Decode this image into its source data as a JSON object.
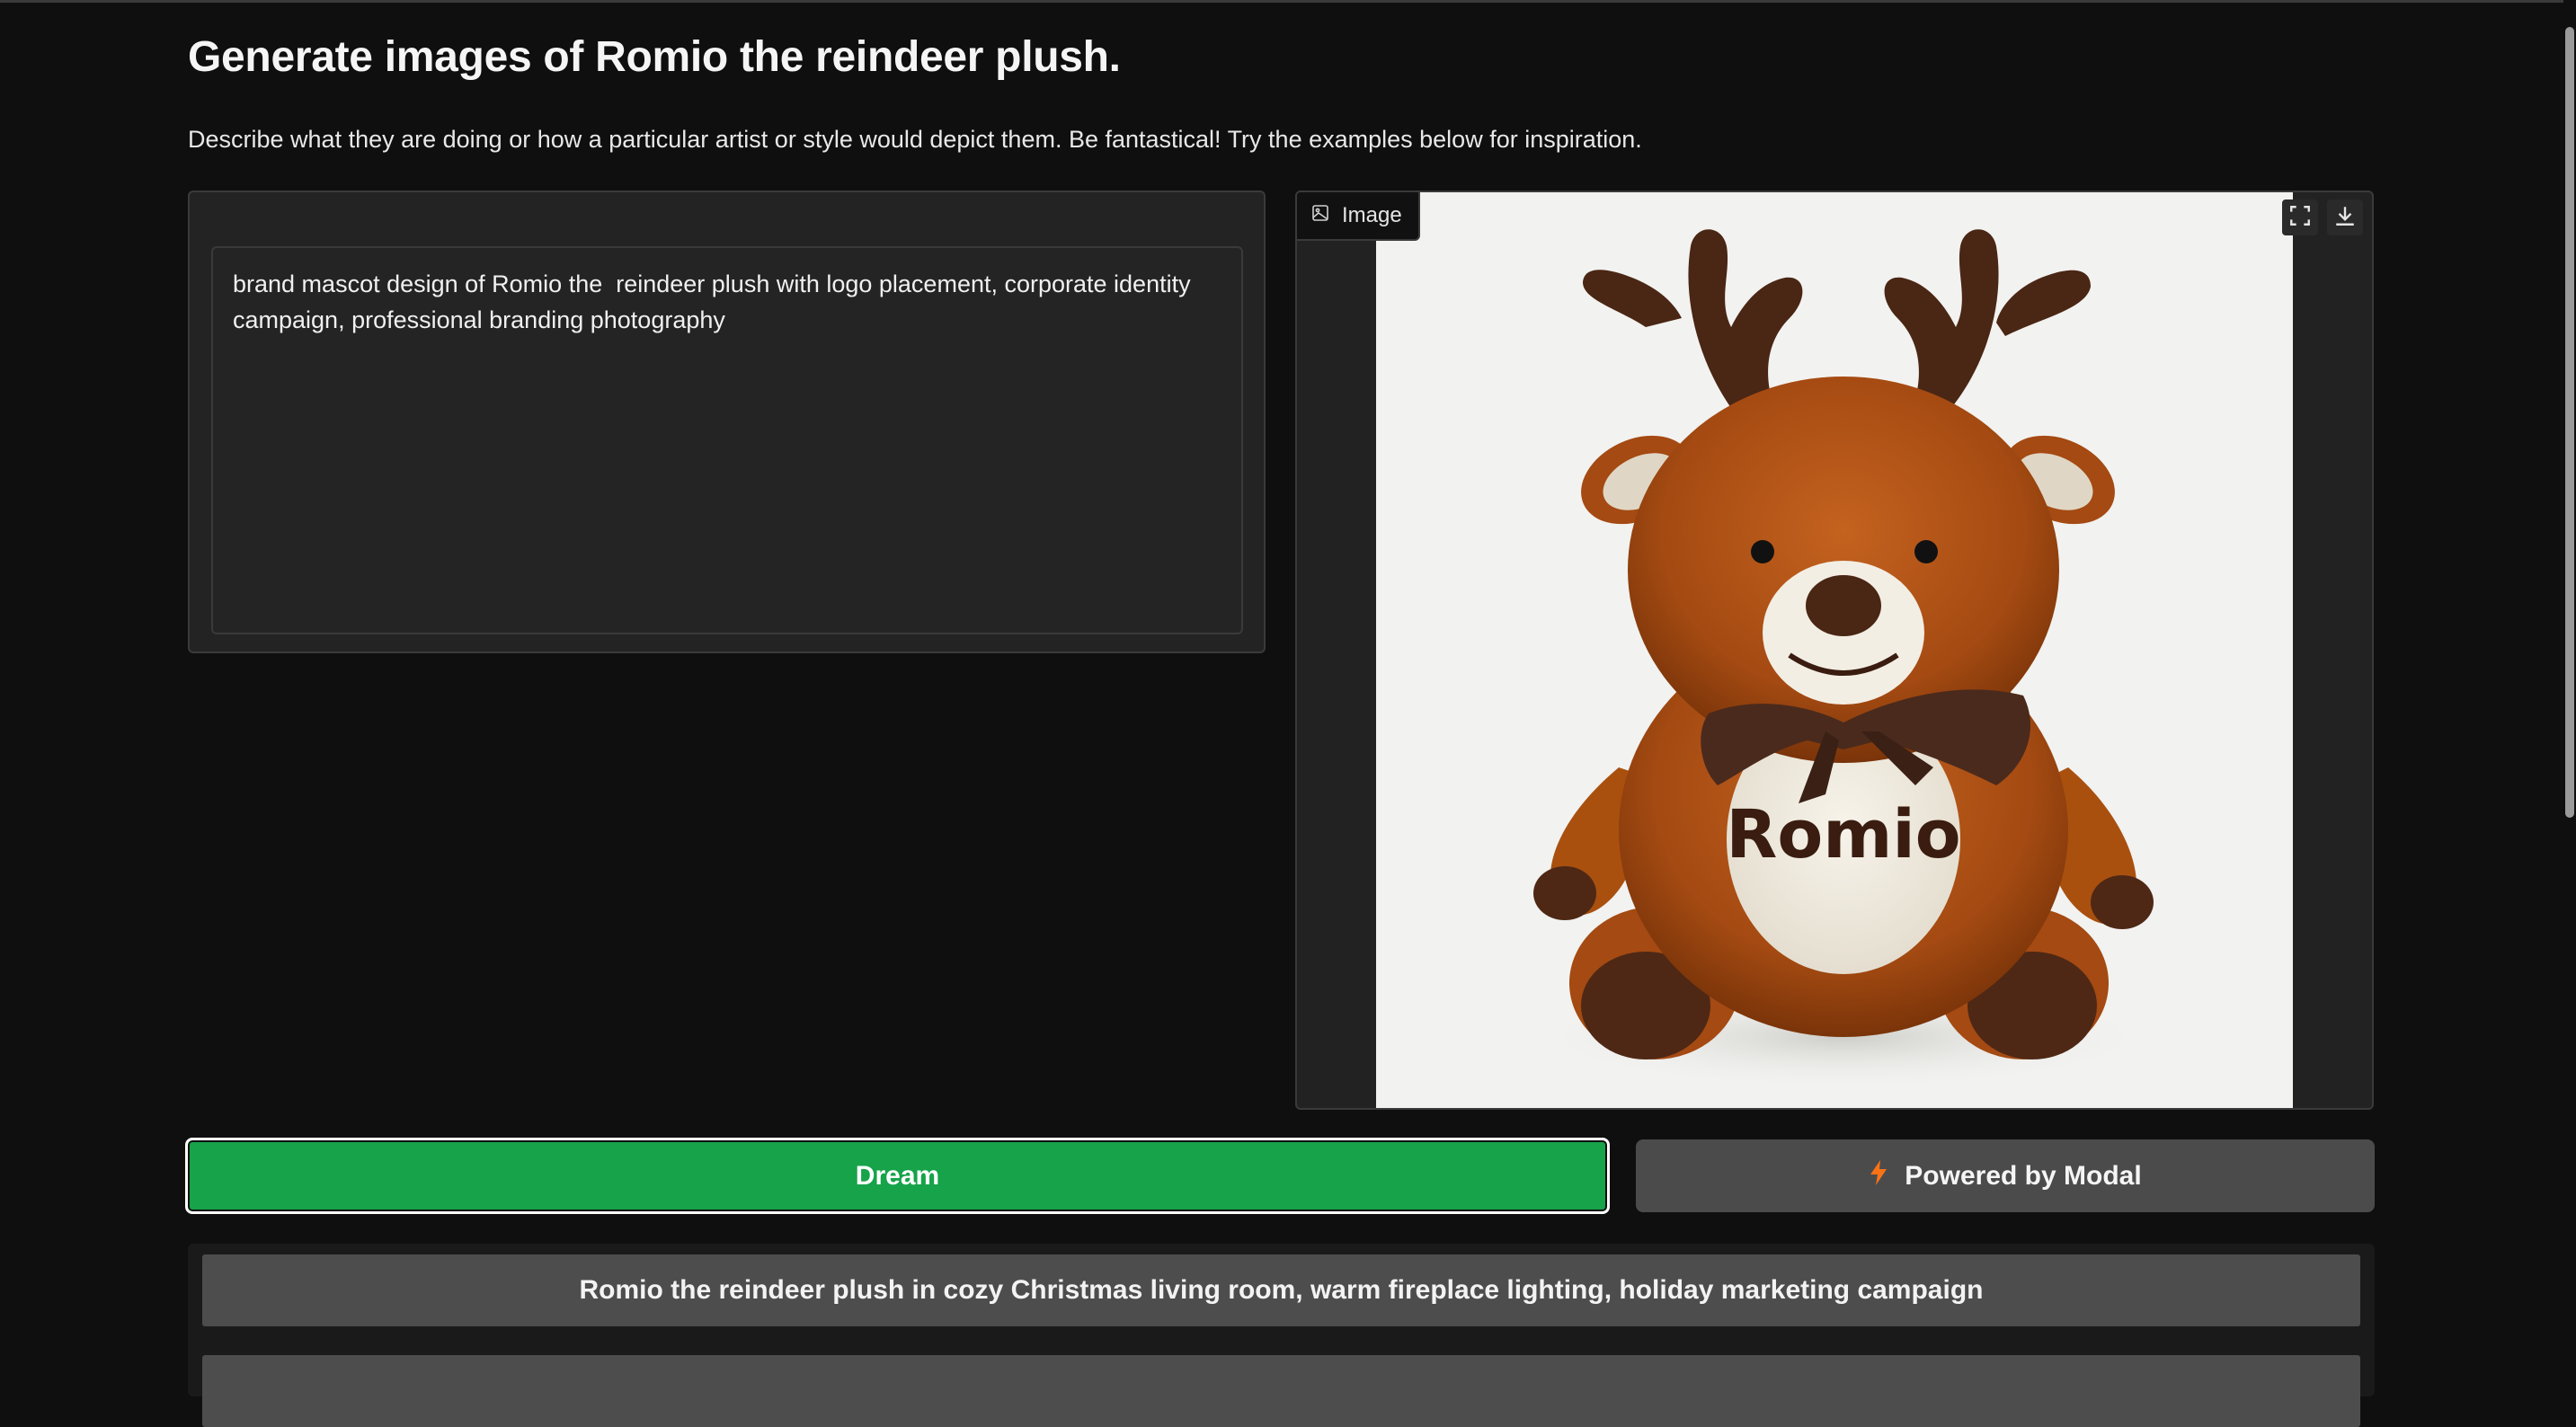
{
  "header": {
    "title": "Generate images of Romio the reindeer plush.",
    "description": "Describe what they are doing or how a particular artist or style would depict them. Be fantastical! Try the examples below for inspiration."
  },
  "prompt": {
    "value": "brand mascot design of Romio the  reindeer plush with logo placement, corporate identity campaign, professional branding photography"
  },
  "output": {
    "label": "Image",
    "icon": "image-icon",
    "tools": [
      "fullscreen-icon",
      "download-icon"
    ],
    "plush_text": "Romio"
  },
  "actions": {
    "dream_label": "Dream",
    "modal_label": "Powered by Modal",
    "dream_color": "#16a34a"
  },
  "examples": [
    "Romio the reindeer plush in cozy Christmas living room, warm fireplace lighting, holiday marketing campaign",
    ""
  ]
}
